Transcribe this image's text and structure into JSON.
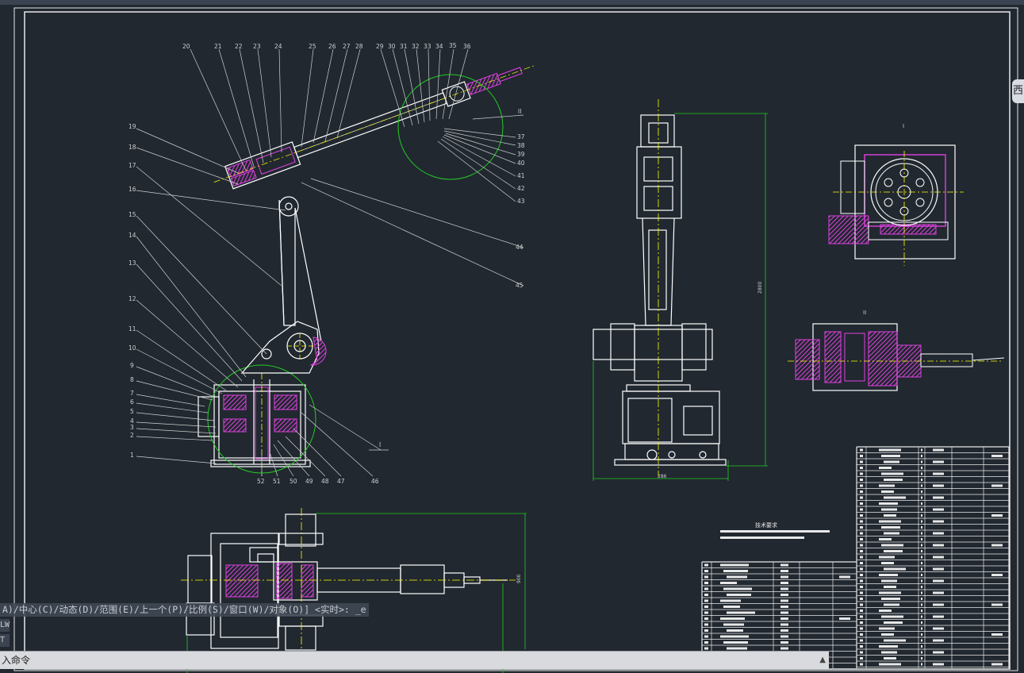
{
  "window": {
    "nav_badge": "西"
  },
  "drawing": {
    "left_callouts": [
      "20",
      "21",
      "22",
      "23",
      "24",
      "25",
      "26",
      "27",
      "28",
      "29",
      "30",
      "31",
      "32",
      "33",
      "34",
      "35",
      "36"
    ],
    "side_callouts": [
      "19",
      "18",
      "17",
      "16",
      "15",
      "14",
      "13",
      "12",
      "11",
      "10",
      "9",
      "8",
      "7",
      "6",
      "5",
      "4",
      "3",
      "2",
      "1"
    ],
    "right_callouts": [
      "37",
      "38",
      "39",
      "40",
      "41",
      "42",
      "43",
      "44",
      "45"
    ],
    "bottom_callouts": [
      "52",
      "51",
      "50",
      "49",
      "48",
      "47",
      "46"
    ],
    "detail_label_I": "I",
    "detail_label_II": "II",
    "dim_height": "2800",
    "dim_width": "286",
    "dim_bottom_side": "900",
    "tech_title": "技术要求"
  },
  "command": {
    "history_text": "A)/中心(C)/动态(D)/范围(E)/上一个(P)/比例(S)/窗口(W)/对象(O)] <实时>: _e",
    "history_line_2": "LW",
    "history_line_3": "T",
    "prompt": "入命令",
    "input_value": "",
    "up_arrow": "▲"
  }
}
